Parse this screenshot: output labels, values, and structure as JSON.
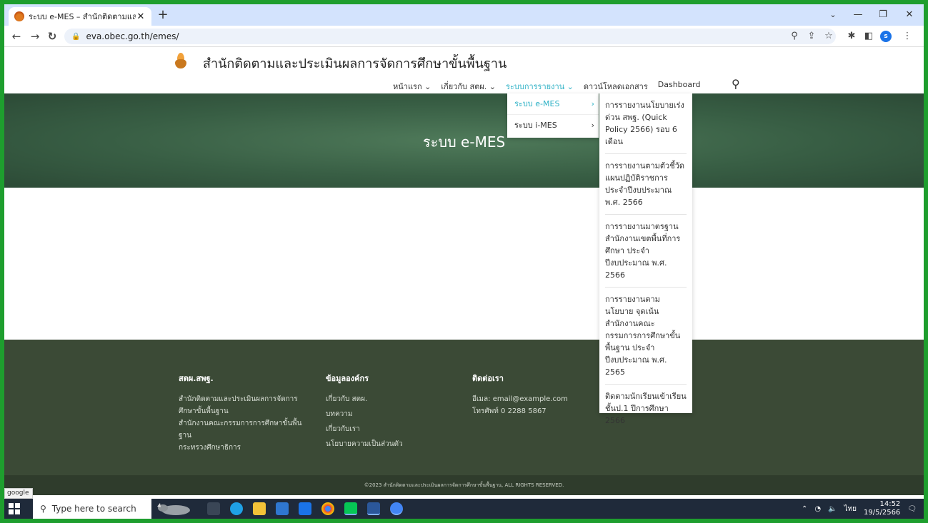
{
  "browser": {
    "tab_title": "ระบบ e-MES – สำนักติดตามและประเมิ",
    "tab_close": "✕",
    "new_tab": "+",
    "url": "eva.obec.go.th/emes/",
    "window_min": "—",
    "window_restore": "❐",
    "window_close": "✕",
    "tab_search": "⌄"
  },
  "site": {
    "name": "สำนักติดตามและประเมินผลการจัดการศึกษาขั้นพื้นฐาน",
    "nav": {
      "home": "หน้าแรก ⌄",
      "about": "เกี่ยวกับ สตผ. ⌄",
      "report": "ระบบการรายงาน ⌄",
      "download": "ดาวน์โหลดเอกสาร",
      "dashboard": "Dashboard"
    },
    "hero_title": "ระบบ e-MES"
  },
  "menu_level1": {
    "emes": "ระบบ e-MES",
    "imes": "ระบบ i-MES",
    "arrow": "›"
  },
  "menu_level2": [
    "การรายงานนโยบายเร่งด่วน สพฐ. (Quick Policy 2566) รอบ 6 เดือน",
    "การรายงานตามตัวชี้วัดแผนปฏิบัติราชการ ประจำปีงบประมาณ พ.ศ. 2566",
    "การรายงานมาตรฐานสำนักงานเขตพื้นที่การศึกษา ประจำปีงบประมาณ พ.ศ. 2566",
    "การรายงานตามนโยบาย จุดเน้นสำนักงานคณะกรรมการการศึกษาขั้นพื้นฐาน ประจำปีงบประมาณ พ.ศ. 2565",
    "ติดตามนักเรียนเข้าเรียนชั้นป.1 ปีการศึกษา 2566"
  ],
  "footer": {
    "col1": {
      "head": "สตผ.สพฐ.",
      "lines": [
        "สำนักติดตามและประเมินผลการจัดการศึกษาขั้นพื้นฐาน",
        "สำนักงานคณะกรรมการการศึกษาขั้นพื้นฐาน",
        "กระทรวงศึกษาธิการ"
      ]
    },
    "col2": {
      "head": "ข้อมูลองค์กร",
      "links": [
        "เกี่ยวกับ สตผ.",
        "บทความ",
        "เกี่ยวกับเรา",
        "นโยบายความเป็นส่วนตัว"
      ]
    },
    "col3": {
      "head": "ติดต่อเรา",
      "email": "อีเมล: email@example.com",
      "phone": "โทรศัพท์ 0 2288 5867"
    },
    "copyright": "©2023 สำนักติดตามและประเมินผลการจัดการศึกษาขั้นพื้นฐาน, ALL RIGHTS RESERVED."
  },
  "tooltip": "google",
  "taskbar": {
    "search_placeholder": "Type here to search",
    "lang": "ไทย",
    "time": "14:52",
    "date": "19/5/2566"
  },
  "colors": {
    "accent": "#2bb0c5",
    "footer_bg": "#3b4a36",
    "outer_frame": "#1e9e2e"
  }
}
